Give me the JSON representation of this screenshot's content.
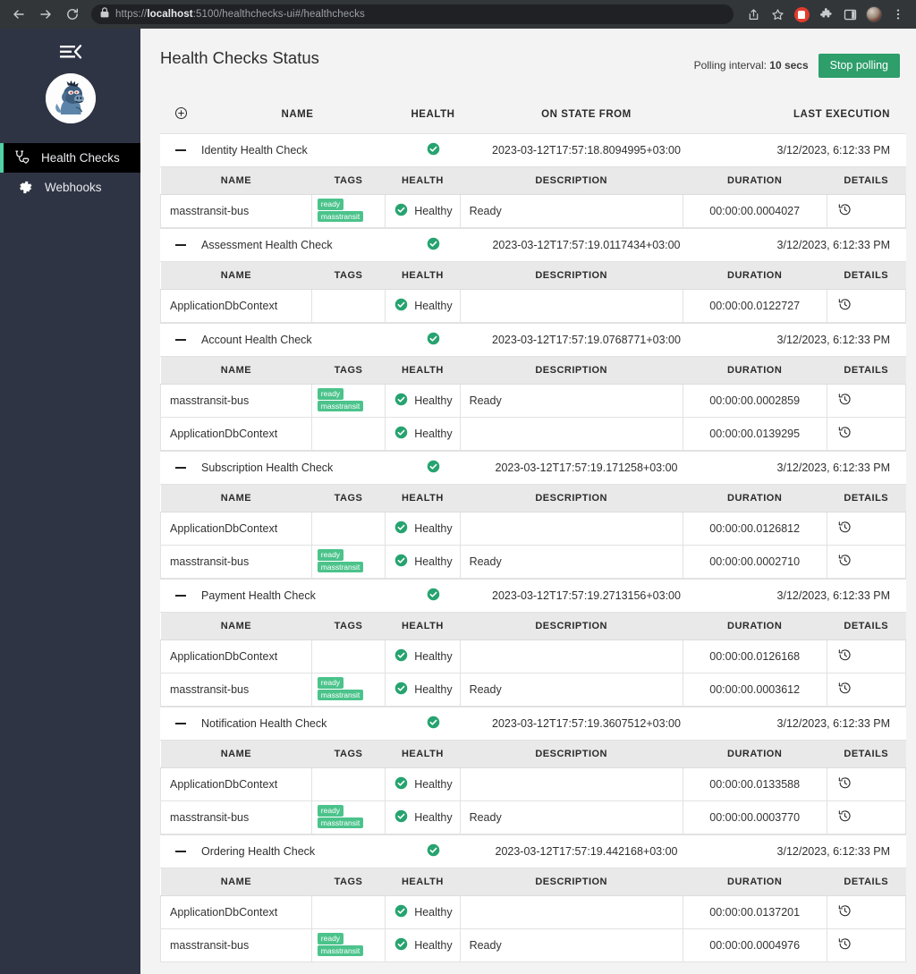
{
  "browser": {
    "back_icon": "back-arrow-icon",
    "forward_icon": "forward-arrow-icon",
    "reload_icon": "reload-icon",
    "lock_icon": "lock-icon",
    "url_scheme": "https://",
    "url_host": "localhost",
    "url_rest": ":5100/healthchecks-ui#/healthchecks",
    "share_icon": "share-icon",
    "bookmark_icon": "star-icon",
    "extension_stop_icon": "extension-blocker-icon",
    "extensions_icon": "puzzle-piece-icon",
    "sidepanel_icon": "side-panel-icon",
    "profile_icon": "profile-avatar-icon",
    "menu_icon": "three-dot-menu-icon"
  },
  "sidebar": {
    "toggle_icon": "collapse-menu-icon",
    "logo_icon": "app-mascot-logo",
    "items": [
      {
        "label": "Health Checks",
        "icon": "stethoscope-heart-icon",
        "active": true
      },
      {
        "label": "Webhooks",
        "icon": "gear-icon",
        "active": false
      }
    ]
  },
  "header": {
    "title": "Health Checks Status",
    "polling_label": "Polling interval:",
    "polling_value": "10 secs",
    "stop_button": "Stop polling"
  },
  "colors": {
    "accent_green": "#2e9e6b",
    "tag_green": "#4bc38b",
    "healthy_green": "#26a36f",
    "sidebar_bg": "#2f3445",
    "active_border": "#4fd1a5"
  },
  "table": {
    "expand_all_icon": "plus-circle-icon",
    "columns": [
      "NAME",
      "HEALTH",
      "ON STATE FROM",
      "LAST EXECUTION"
    ],
    "detail_columns": [
      "NAME",
      "TAGS",
      "HEALTH",
      "DESCRIPTION",
      "DURATION",
      "DETAILS"
    ],
    "collapse_icon": "minus-icon",
    "health_icon": "check-circle-icon",
    "details_icon": "history-clock-icon",
    "groups": [
      {
        "name": "Identity Health Check",
        "health": "check-circle-icon",
        "on_state_from": "2023-03-12T17:57:18.8094995+03:00",
        "last_execution": "3/12/2023, 6:12:33 PM",
        "entries": [
          {
            "name": "masstransit-bus",
            "tags": [
              "ready",
              "masstransit"
            ],
            "health": "Healthy",
            "description": "Ready",
            "duration": "00:00:00.0004027"
          }
        ]
      },
      {
        "name": "Assessment Health Check",
        "health": "check-circle-icon",
        "on_state_from": "2023-03-12T17:57:19.0117434+03:00",
        "last_execution": "3/12/2023, 6:12:33 PM",
        "entries": [
          {
            "name": "ApplicationDbContext",
            "tags": [],
            "health": "Healthy",
            "description": "",
            "duration": "00:00:00.0122727"
          }
        ]
      },
      {
        "name": "Account Health Check",
        "health": "check-circle-icon",
        "on_state_from": "2023-03-12T17:57:19.0768771+03:00",
        "last_execution": "3/12/2023, 6:12:33 PM",
        "entries": [
          {
            "name": "masstransit-bus",
            "tags": [
              "ready",
              "masstransit"
            ],
            "health": "Healthy",
            "description": "Ready",
            "duration": "00:00:00.0002859"
          },
          {
            "name": "ApplicationDbContext",
            "tags": [],
            "health": "Healthy",
            "description": "",
            "duration": "00:00:00.0139295"
          }
        ]
      },
      {
        "name": "Subscription Health Check",
        "health": "check-circle-icon",
        "on_state_from": "2023-03-12T17:57:19.171258+03:00",
        "last_execution": "3/12/2023, 6:12:33 PM",
        "entries": [
          {
            "name": "ApplicationDbContext",
            "tags": [],
            "health": "Healthy",
            "description": "",
            "duration": "00:00:00.0126812"
          },
          {
            "name": "masstransit-bus",
            "tags": [
              "ready",
              "masstransit"
            ],
            "health": "Healthy",
            "description": "Ready",
            "duration": "00:00:00.0002710"
          }
        ]
      },
      {
        "name": "Payment Health Check",
        "health": "check-circle-icon",
        "on_state_from": "2023-03-12T17:57:19.2713156+03:00",
        "last_execution": "3/12/2023, 6:12:33 PM",
        "entries": [
          {
            "name": "ApplicationDbContext",
            "tags": [],
            "health": "Healthy",
            "description": "",
            "duration": "00:00:00.0126168"
          },
          {
            "name": "masstransit-bus",
            "tags": [
              "ready",
              "masstransit"
            ],
            "health": "Healthy",
            "description": "Ready",
            "duration": "00:00:00.0003612"
          }
        ]
      },
      {
        "name": "Notification Health Check",
        "health": "check-circle-icon",
        "on_state_from": "2023-03-12T17:57:19.3607512+03:00",
        "last_execution": "3/12/2023, 6:12:33 PM",
        "entries": [
          {
            "name": "ApplicationDbContext",
            "tags": [],
            "health": "Healthy",
            "description": "",
            "duration": "00:00:00.0133588"
          },
          {
            "name": "masstransit-bus",
            "tags": [
              "ready",
              "masstransit"
            ],
            "health": "Healthy",
            "description": "Ready",
            "duration": "00:00:00.0003770"
          }
        ]
      },
      {
        "name": "Ordering Health Check",
        "health": "check-circle-icon",
        "on_state_from": "2023-03-12T17:57:19.442168+03:00",
        "last_execution": "3/12/2023, 6:12:33 PM",
        "entries": [
          {
            "name": "ApplicationDbContext",
            "tags": [],
            "health": "Healthy",
            "description": "",
            "duration": "00:00:00.0137201"
          },
          {
            "name": "masstransit-bus",
            "tags": [
              "ready",
              "masstransit"
            ],
            "health": "Healthy",
            "description": "Ready",
            "duration": "00:00:00.0004976"
          }
        ]
      }
    ]
  }
}
